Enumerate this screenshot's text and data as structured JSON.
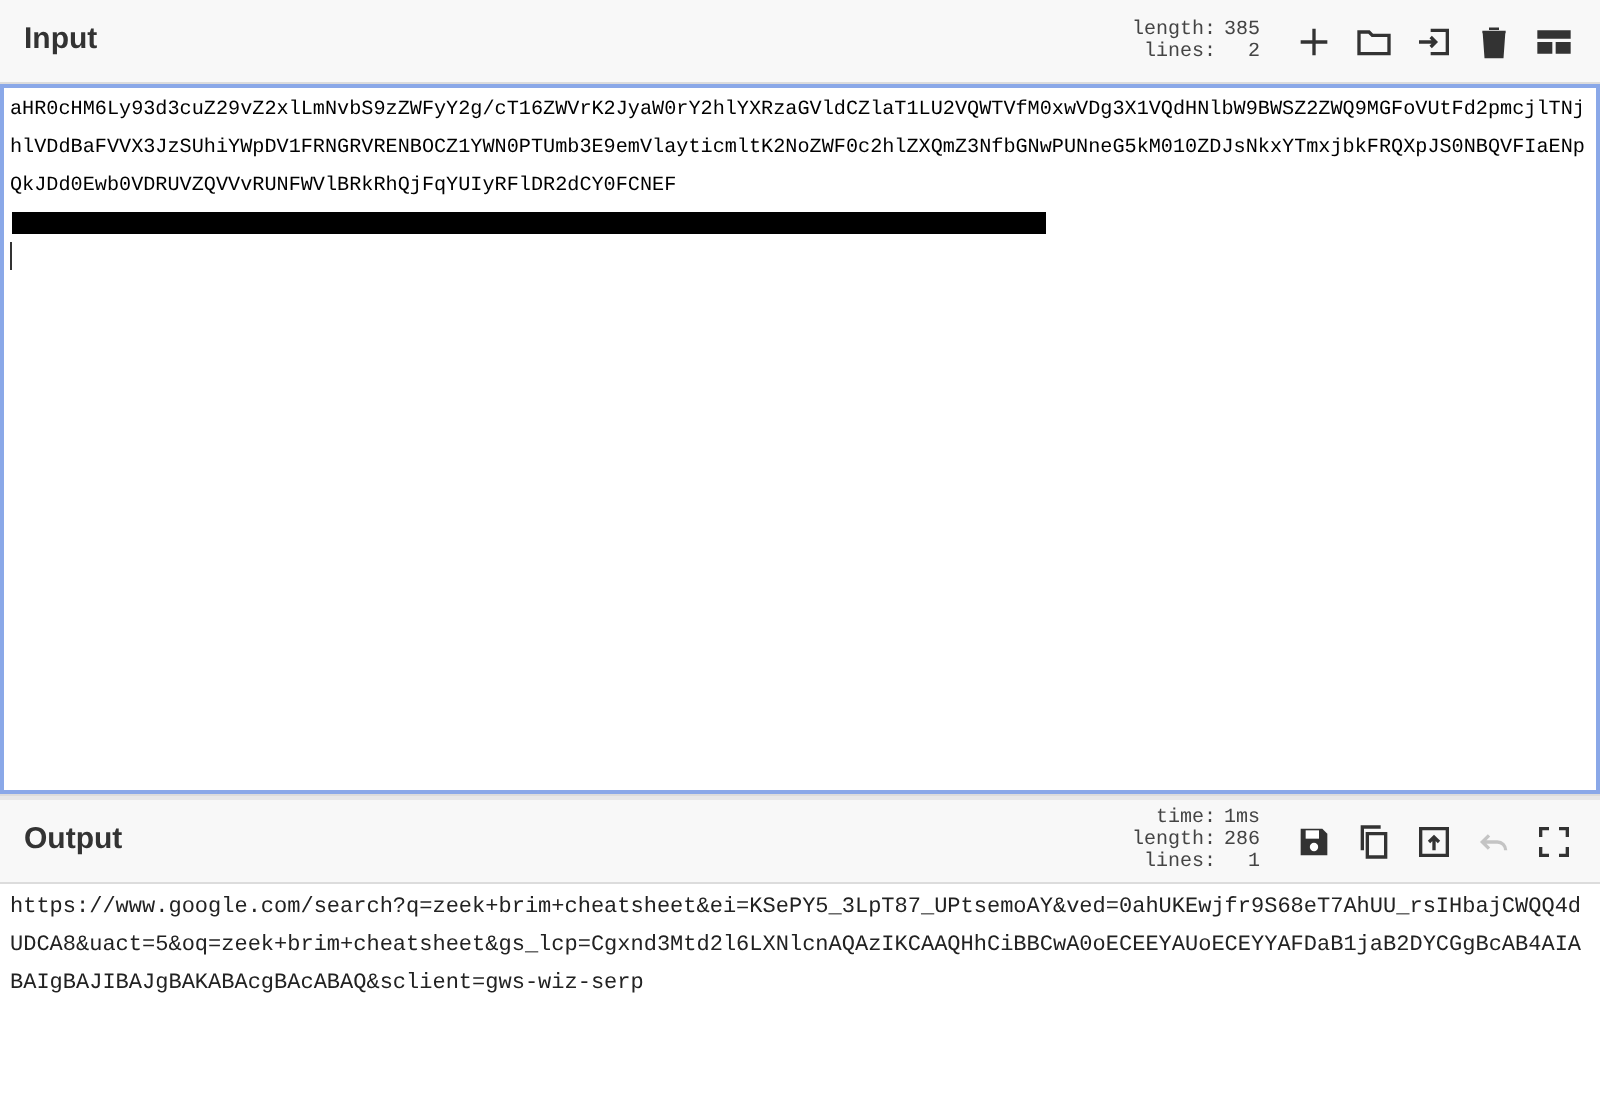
{
  "input": {
    "title": "Input",
    "stats": [
      {
        "label": "length:",
        "value": "385"
      },
      {
        "label": "lines:",
        "value": "2"
      }
    ],
    "buttons": [
      {
        "kind": "plus",
        "disabled": false
      },
      {
        "kind": "folder",
        "disabled": false
      },
      {
        "kind": "import",
        "disabled": false
      },
      {
        "kind": "trash",
        "disabled": false
      },
      {
        "kind": "layout",
        "disabled": false
      }
    ],
    "value": "aHR0cHM6Ly93d3cuZ29vZ2xlLmNvbS9zZWFyY2g/cT16ZWVrK2JyaW0rY2hlYXRzaGVldCZlaT1LU2VQWTVfM0xwVDg3X1VQdHNlbW9BWSZ2ZWQ9MGFoVUtFd2pmcjlTNjhlVDdBaFVVX3JzSUhiYWpDV1FRNGRVRENBOCZ1YWN0PTUmb3E9emVlayticmltK2NoZWF0c2hlZXQmZ3NfbGNwPUNneG5kM010ZDJsNkxYTmxjbkFRQXpJS0NBQVFIaENpQkJDd0Ewb0VDRUVZQVVvRUNFWVlBRkRhQjFqYUIyRFlDR2dCY0FCNEF",
    "redacted": true,
    "focused": true
  },
  "output": {
    "title": "Output",
    "stats": [
      {
        "label": "time:",
        "value": "1ms"
      },
      {
        "label": "length:",
        "value": "286"
      },
      {
        "label": "lines:",
        "value": "1"
      }
    ],
    "buttons": [
      {
        "kind": "save",
        "disabled": false
      },
      {
        "kind": "copy",
        "disabled": false
      },
      {
        "kind": "replace",
        "disabled": false
      },
      {
        "kind": "undo",
        "disabled": true
      },
      {
        "kind": "maximize",
        "disabled": false
      }
    ],
    "value": "https://www.google.com/search?q=zeek+brim+cheatsheet&ei=KSePY5_3LpT87_UPtsemoAY&ved=0ahUKEwjfr9S68eT7AhUU_rsIHbajCWQQ4dUDCA8&uact=5&oq=zeek+brim+cheatsheet&gs_lcp=Cgxnd3Mtd2l6LXNlcnAQAzIKCAAQHhCiBBCwA0oECEEYAUoECEYYAFDaB1jaB2DYCGgBcAB4AIABAIgBAJIBAJgBAKABAcgBAcABAQ&sclient=gws-wiz-serp"
  }
}
